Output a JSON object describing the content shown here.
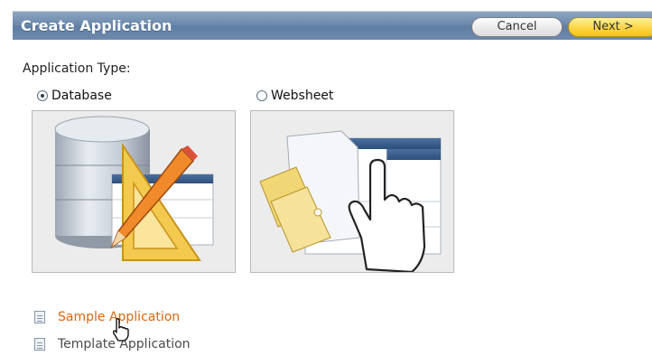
{
  "header": {
    "title": "Create Application",
    "cancel_label": "Cancel",
    "next_label": "Next >"
  },
  "application_type": {
    "label": "Application Type:",
    "options": [
      {
        "label": "Database",
        "selected": true
      },
      {
        "label": "Websheet",
        "selected": false
      }
    ]
  },
  "links": [
    {
      "label": "Sample Application",
      "state": "hover"
    },
    {
      "label": "Template Application",
      "state": "normal"
    }
  ],
  "colors": {
    "title_bar": "#6a87aa",
    "next_button": "#ffd84a",
    "link_hover": "#e0650a"
  }
}
